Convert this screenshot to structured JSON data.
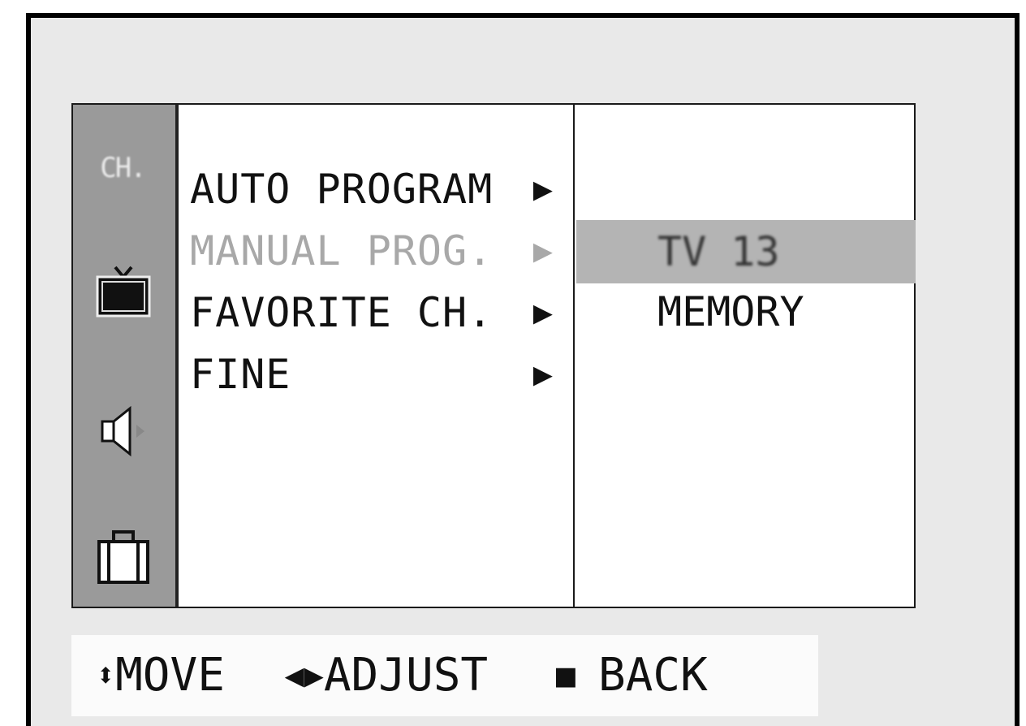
{
  "rail": {
    "label": "CH.",
    "icons": [
      "tv-icon",
      "speaker-icon",
      "suitcase-icon"
    ]
  },
  "menu": {
    "items": [
      {
        "label": "AUTO PROGRAM",
        "arrow": "▶",
        "state": "normal"
      },
      {
        "label": "MANUAL PROG.",
        "arrow": "▶",
        "state": "dimmed"
      },
      {
        "label": "FAVORITE CH.",
        "arrow": "▶",
        "state": "normal"
      },
      {
        "label": "FINE",
        "arrow": "▶",
        "state": "normal"
      }
    ]
  },
  "submenu": {
    "selected_channel": "TV 13",
    "memory_label": "MEMORY"
  },
  "help": {
    "move_glyph": "⬍",
    "move_label": "MOVE",
    "adjust_glyph": "◀▶",
    "adjust_label": "ADJUST",
    "back_glyph": "■",
    "back_label": "BACK"
  },
  "colors": {
    "rail_background": "#9a9a9a",
    "highlight": "#b4b4b4",
    "dimmed_text": "#a8a8a8",
    "frame": "#000000"
  }
}
